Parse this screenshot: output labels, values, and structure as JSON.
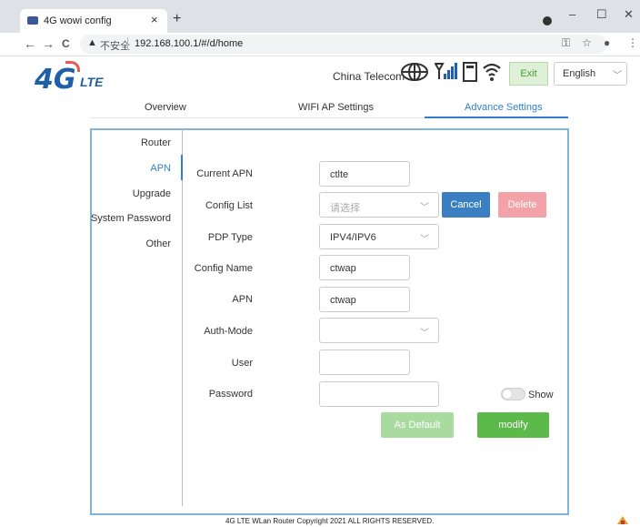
{
  "browser": {
    "tab_title": "4G wowi config",
    "tab_close": "×",
    "new_tab": "+",
    "window_min": "–",
    "window_max": "☐",
    "window_close": "✕",
    "nav_back": "←",
    "nav_forward": "→",
    "nav_reload": "C",
    "insecure_label": "不安全",
    "url": "192.168.100.1/#/d/home"
  },
  "header": {
    "logo_text": "4G",
    "logo_sub": "LTE",
    "carrier": "China Telecom",
    "exit_label": "Exit",
    "language": "English"
  },
  "tabs": [
    {
      "label": "Overview"
    },
    {
      "label": "WIFI AP Settings"
    },
    {
      "label": "Advance Settings"
    }
  ],
  "sidebar": {
    "items": [
      {
        "label": "Router"
      },
      {
        "label": "APN"
      },
      {
        "label": "Upgrade"
      },
      {
        "label": "System Password"
      },
      {
        "label": "Other"
      }
    ],
    "active": "APN"
  },
  "form": {
    "current_apn_label": "Current APN",
    "current_apn_value": "ctlte",
    "config_list_label": "Config List",
    "config_list_placeholder": "请选择",
    "pdp_type_label": "PDP Type",
    "pdp_type_value": "IPV4/IPV6",
    "config_name_label": "Config Name",
    "config_name_value": "ctwap",
    "apn_label": "APN",
    "apn_value": "ctwap",
    "auth_mode_label": "Auth-Mode",
    "auth_mode_value": "",
    "user_label": "User",
    "user_value": "",
    "password_label": "Password",
    "password_value": "",
    "show_label": "Show",
    "show_enabled": false
  },
  "buttons": {
    "cancel": "Cancel",
    "delete": "Delete",
    "as_default": "As Default",
    "modify": "modify"
  },
  "footer": {
    "copyright": "4G LTE WLan Router Copyright 2021 ALL RIGHTS RESERVED."
  },
  "colors": {
    "accent": "#2f7fd0",
    "panel_border": "#7fb5dc",
    "cancel": "#3a7fc2",
    "delete": "#f3a3a8",
    "modify": "#5cba4a",
    "as_default": "#a9dba0"
  }
}
